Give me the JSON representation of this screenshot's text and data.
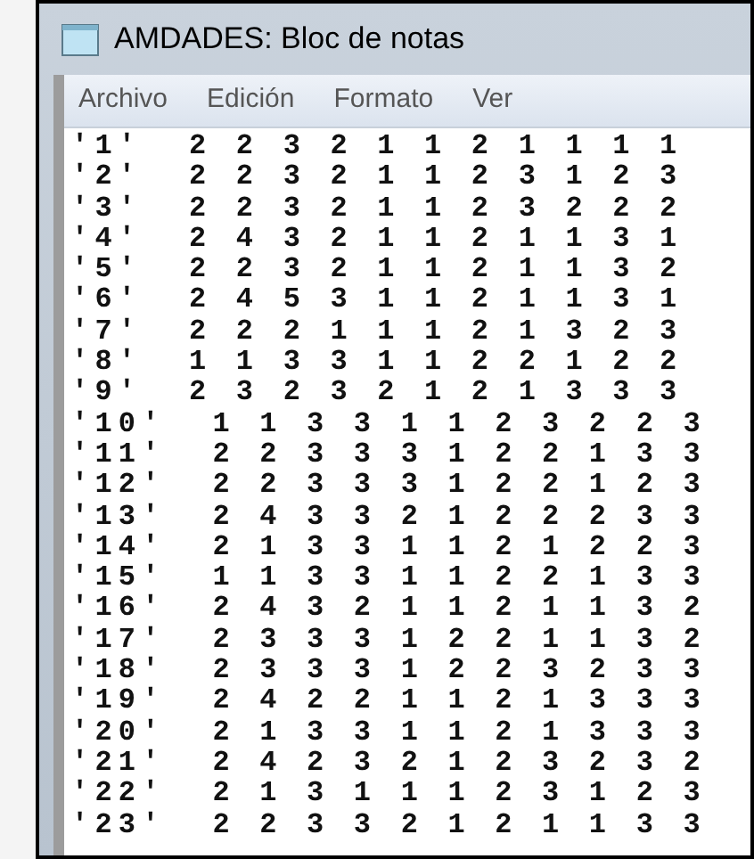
{
  "window": {
    "title": "AMDADES: Bloc de notas"
  },
  "menu": [
    "Archivo",
    "Edición",
    "Formato",
    "Ver"
  ],
  "text_lines": [
    "'1'  2 2 3 2 1 1 2 1 1 1 1",
    "'2'  2 2 3 2 1 1 2 3 1 2 3",
    "'3'  2 2 3 2 1 1 2 3 2 2 2",
    "'4'  2 4 3 2 1 1 2 1 1 3 1",
    "'5'  2 2 3 2 1 1 2 1 1 3 2",
    "'6'  2 4 5 3 1 1 2 1 1 3 1",
    "'7'  2 2 2 1 1 1 2 1 3 2 3",
    "'8'  1 1 3 3 1 1 2 2 1 2 2",
    "'9'  2 3 2 3 2 1 2 1 3 3 3",
    "'10'  1 1 3 3 1 1 2 3 2 2 3",
    "'11'  2 2 3 3 3 1 2 2 1 3 3",
    "'12'  2 2 3 3 3 1 2 2 1 2 3",
    "'13'  2 4 3 3 2 1 2 2 2 3 3",
    "'14'  2 1 3 3 1 1 2 1 2 2 3",
    "'15'  1 1 3 3 1 1 2 2 1 3 3",
    "'16'  2 4 3 2 1 1 2 1 1 3 2",
    "'17'  2 3 3 3 1 2 2 1 1 3 2",
    "'18'  2 3 3 3 1 2 2 3 2 3 3",
    "'19'  2 4 2 2 1 1 2 1 3 3 3",
    "'20'  2 1 3 3 1 1 2 1 3 3 3",
    "'21'  2 4 2 3 2 1 2 3 2 3 2",
    "'22'  2 1 3 1 1 1 2 3 1 2 3",
    "'23'  2 2 3 3 2 1 2 1 1 3 3"
  ]
}
